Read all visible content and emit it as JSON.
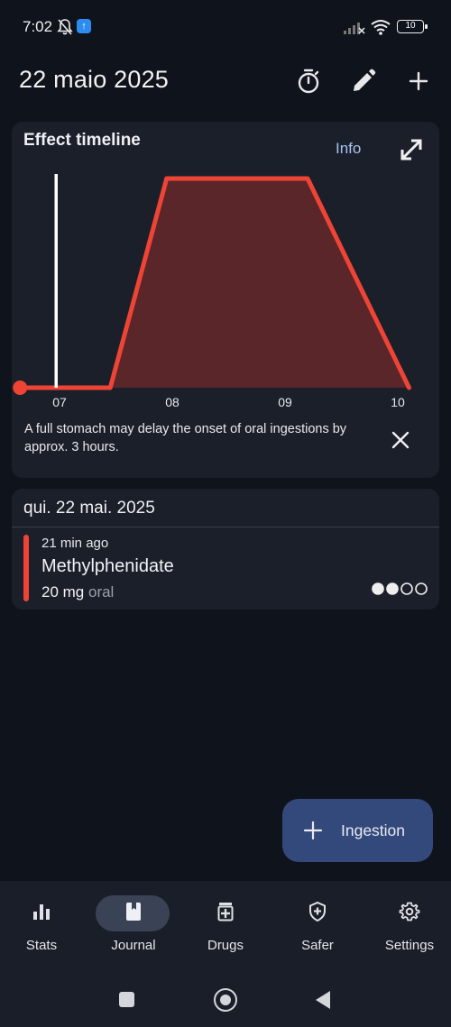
{
  "status_bar": {
    "time": "7:02",
    "battery": "10"
  },
  "header": {
    "title": "22 maio 2025",
    "icons": [
      "timer-icon",
      "edit-icon",
      "add-icon"
    ]
  },
  "timeline_card": {
    "title": "Effect timeline",
    "info_label": "Info",
    "note": "A full stomach may delay the onset of oral ingestions by approx. 3 hours.",
    "accent_color": "#ee4436",
    "fill_color": "#5a2629"
  },
  "chart_data": {
    "type": "area",
    "title": "Effect timeline",
    "x_ticks": [
      "07",
      "08",
      "09",
      "10"
    ],
    "x": [
      6.65,
      7.45,
      7.95,
      9.2,
      10.1
    ],
    "y": [
      0,
      0,
      1,
      1,
      0
    ],
    "ylim": [
      0,
      1
    ],
    "current_time_marker": 6.97,
    "ingestion_point": 6.65
  },
  "day_card": {
    "title": "qui. 22 mai. 2025",
    "ingestion": {
      "time_ago": "21 min ago",
      "substance": "Methylphenidate",
      "dose": "20 mg",
      "route": "oral",
      "dots_filled": 2,
      "dots_total": 4
    }
  },
  "fab": {
    "label": "Ingestion"
  },
  "bottom_nav": {
    "items": [
      {
        "label": "Stats",
        "icon": "bar-chart-icon",
        "active": false
      },
      {
        "label": "Journal",
        "icon": "journal-icon",
        "active": true
      },
      {
        "label": "Drugs",
        "icon": "medicine-icon",
        "active": false
      },
      {
        "label": "Safer",
        "icon": "shield-icon",
        "active": false
      },
      {
        "label": "Settings",
        "icon": "gear-icon",
        "active": false
      }
    ]
  }
}
